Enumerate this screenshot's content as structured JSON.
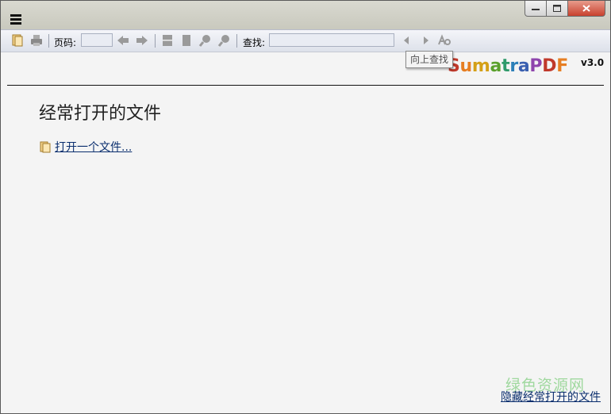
{
  "toolbar": {
    "page_label": "页码:",
    "page_value": "",
    "find_label": "查找:",
    "find_value": ""
  },
  "tooltip": {
    "text": "向上查找"
  },
  "brand": {
    "letters": [
      {
        "ch": "S",
        "color": "#c0392b"
      },
      {
        "ch": "u",
        "color": "#e67e22"
      },
      {
        "ch": "m",
        "color": "#d4a017"
      },
      {
        "ch": "a",
        "color": "#5aa02c"
      },
      {
        "ch": "t",
        "color": "#2e9a6a"
      },
      {
        "ch": "r",
        "color": "#2c7fb8"
      },
      {
        "ch": "a",
        "color": "#3a5fb0"
      },
      {
        "ch": "P",
        "color": "#8e44ad"
      },
      {
        "ch": "D",
        "color": "#c0392b"
      },
      {
        "ch": "F",
        "color": "#e67e22"
      }
    ],
    "version": "v3.0"
  },
  "main": {
    "heading": "经常打开的文件",
    "open_file_label": "打开一个文件...",
    "hide_label": "隐藏经常打开的文件"
  },
  "watermark": {
    "text": "绿色资源网"
  },
  "icons": {
    "menu": "hamburger-menu-icon",
    "open": "open-folder-icon",
    "print": "print-icon",
    "prev_page": "arrow-left-icon",
    "next_page": "arrow-right-icon",
    "fit_page": "fit-page-icon",
    "fit_width": "fit-width-icon",
    "zoom_out": "zoom-out-icon",
    "zoom_in": "zoom-in-icon",
    "find_prev": "find-previous-icon",
    "find_next": "find-next-icon",
    "match_case": "match-case-icon"
  }
}
